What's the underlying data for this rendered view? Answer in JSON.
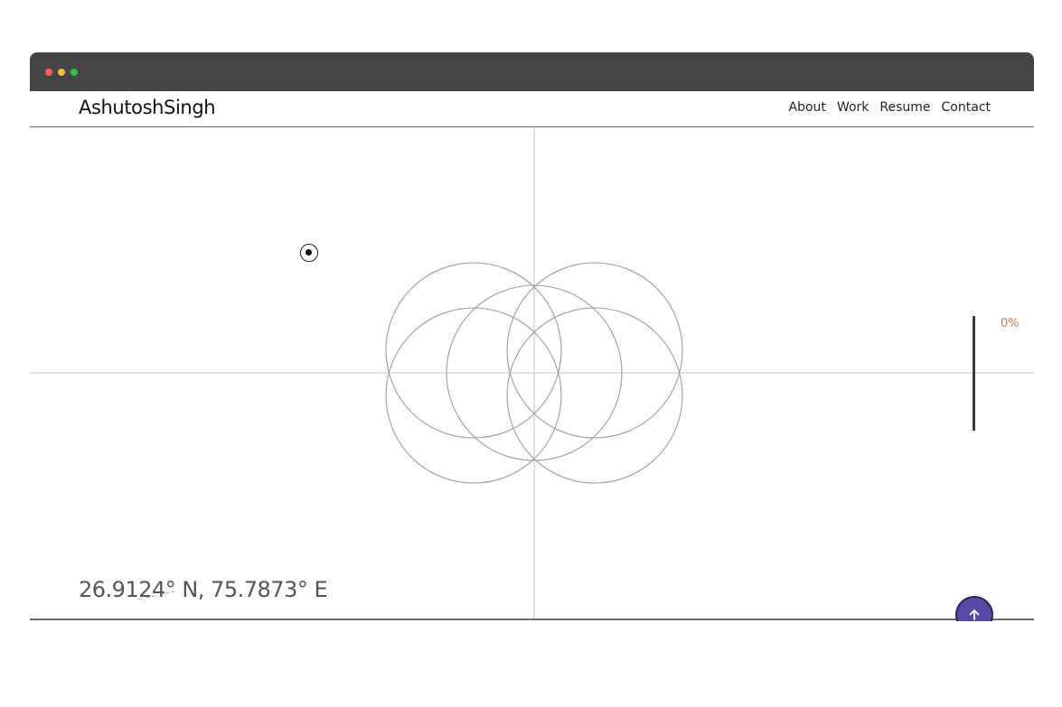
{
  "window": {
    "controls": [
      "close",
      "minimize",
      "maximize"
    ],
    "control_colors": {
      "close": "#ff5f57",
      "minimize": "#febc2e",
      "maximize": "#28c840"
    },
    "titlebar_color": "#444444"
  },
  "header": {
    "brand": "AshutoshSingh",
    "nav": [
      {
        "label": "About"
      },
      {
        "label": "Work"
      },
      {
        "label": "Resume"
      },
      {
        "label": "Contact"
      }
    ]
  },
  "hero": {
    "coordinates": "26.9124° N, 75.7873° E",
    "coordinates_scribble": "~.~~..-~~",
    "progress": {
      "label": "0%",
      "value": 0
    },
    "accent_color": "#c77d5b"
  },
  "scroll_top": {
    "icon": "arrow-up-icon",
    "color": "#5a48a8"
  },
  "cursor": {
    "icon": "cursor-target-icon"
  }
}
